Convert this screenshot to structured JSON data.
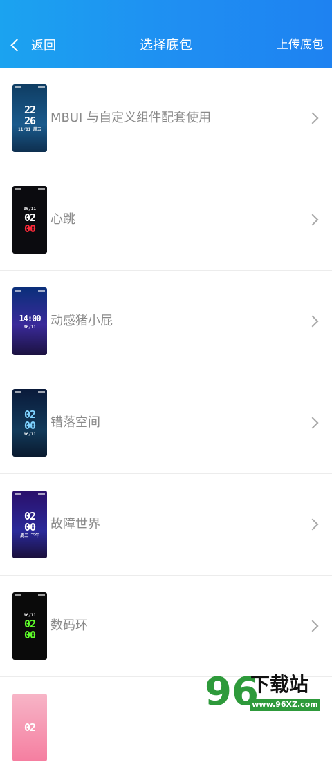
{
  "header": {
    "back_label": "返回",
    "title": "选择底包",
    "upload_label": "上传底包"
  },
  "items": [
    {
      "label": "MBUI 与自定义组件配套使用",
      "thumb_text": "22",
      "thumb_text2": "26",
      "thumb_sub": "11/01 周五"
    },
    {
      "label": "心跳",
      "thumb_text": "02",
      "thumb_text2": "00",
      "thumb_sub": "06/11"
    },
    {
      "label": "动感猪小屁",
      "thumb_text": "14:00",
      "thumb_text2": "",
      "thumb_sub": "06/11"
    },
    {
      "label": "错落空间",
      "thumb_text": "02",
      "thumb_text2": "00",
      "thumb_sub": "06/11"
    },
    {
      "label": "故障世界",
      "thumb_text": "02",
      "thumb_text2": "00",
      "thumb_sub": "周二 下午"
    },
    {
      "label": "数码环",
      "thumb_text": "02",
      "thumb_text2": "00",
      "thumb_sub": "06/11"
    },
    {
      "label": "",
      "thumb_text": "02",
      "thumb_text2": "",
      "thumb_sub": ""
    }
  ],
  "watermark": {
    "number": "96",
    "text": "下载站",
    "url": "www.96XZ.com"
  }
}
